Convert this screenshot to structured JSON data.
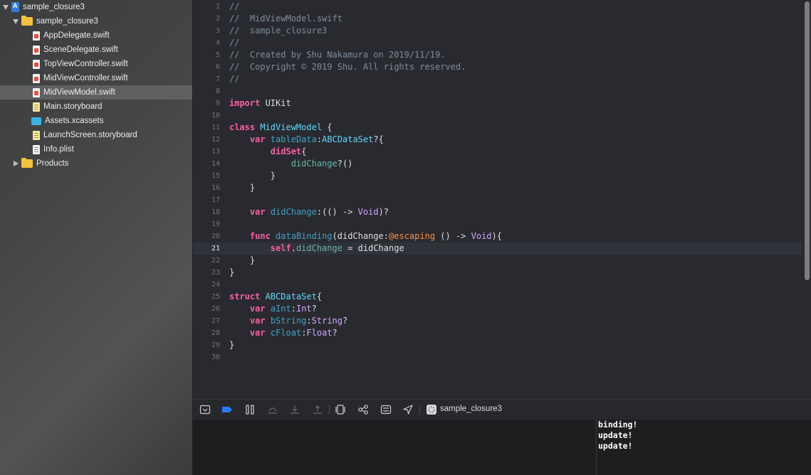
{
  "navigator": {
    "items": [
      {
        "label": "sample_closure3",
        "kind": "project",
        "disclosure": "open"
      },
      {
        "label": "sample_closure3",
        "kind": "folder",
        "disclosure": "open"
      },
      {
        "label": "AppDelegate.swift",
        "kind": "swift"
      },
      {
        "label": "SceneDelegate.swift",
        "kind": "swift"
      },
      {
        "label": "TopViewController.swift",
        "kind": "swift"
      },
      {
        "label": "MidViewController.swift",
        "kind": "swift"
      },
      {
        "label": "MidViewModel.swift",
        "kind": "swift",
        "selected": true
      },
      {
        "label": "Main.storyboard",
        "kind": "storyboard"
      },
      {
        "label": "Assets.xcassets",
        "kind": "assets"
      },
      {
        "label": "LaunchScreen.storyboard",
        "kind": "storyboard"
      },
      {
        "label": "Info.plist",
        "kind": "plist"
      },
      {
        "label": "Products",
        "kind": "folder",
        "disclosure": "closed"
      }
    ]
  },
  "editor": {
    "current_line": 21,
    "lines": [
      {
        "n": "1",
        "tokens": [
          [
            "//",
            "comment"
          ]
        ]
      },
      {
        "n": "2",
        "tokens": [
          [
            "//  MidViewModel.swift",
            "comment"
          ]
        ]
      },
      {
        "n": "3",
        "tokens": [
          [
            "//  sample_closure3",
            "comment"
          ]
        ]
      },
      {
        "n": "4",
        "tokens": [
          [
            "//",
            "comment"
          ]
        ]
      },
      {
        "n": "5",
        "tokens": [
          [
            "//  Created by Shu Nakamura on 2019/11/19.",
            "comment"
          ]
        ]
      },
      {
        "n": "6",
        "tokens": [
          [
            "//  Copyright © 2019 Shu. All rights reserved.",
            "comment"
          ]
        ]
      },
      {
        "n": "7",
        "tokens": [
          [
            "//",
            "comment"
          ]
        ]
      },
      {
        "n": "8",
        "tokens": []
      },
      {
        "n": "9",
        "tokens": [
          [
            "import",
            "keyword"
          ],
          [
            " UIKit",
            "plain"
          ]
        ]
      },
      {
        "n": "10",
        "tokens": []
      },
      {
        "n": "11",
        "tokens": [
          [
            "class",
            "keyword"
          ],
          [
            " ",
            "plain"
          ],
          [
            "MidViewModel",
            "type"
          ],
          [
            " {",
            "plain"
          ]
        ]
      },
      {
        "n": "12",
        "tokens": [
          [
            "    ",
            "plain"
          ],
          [
            "var",
            "keyword"
          ],
          [
            " ",
            "plain"
          ],
          [
            "tableData",
            "prop"
          ],
          [
            ":",
            "plain"
          ],
          [
            "ABCDataSet",
            "type"
          ],
          [
            "?{",
            "plain"
          ]
        ]
      },
      {
        "n": "13",
        "tokens": [
          [
            "        ",
            "plain"
          ],
          [
            "didSet",
            "keyword"
          ],
          [
            "{",
            "plain"
          ]
        ]
      },
      {
        "n": "14",
        "tokens": [
          [
            "            ",
            "plain"
          ],
          [
            "didChange",
            "fn"
          ],
          [
            "?()",
            "plain"
          ]
        ]
      },
      {
        "n": "15",
        "tokens": [
          [
            "        }",
            "plain"
          ]
        ]
      },
      {
        "n": "16",
        "tokens": [
          [
            "    }",
            "plain"
          ]
        ]
      },
      {
        "n": "17",
        "tokens": []
      },
      {
        "n": "18",
        "tokens": [
          [
            "    ",
            "plain"
          ],
          [
            "var",
            "keyword"
          ],
          [
            " ",
            "plain"
          ],
          [
            "didChange",
            "prop"
          ],
          [
            ":(() -> ",
            "plain"
          ],
          [
            "Void",
            "systype"
          ],
          [
            ")?",
            "plain"
          ]
        ]
      },
      {
        "n": "19",
        "tokens": []
      },
      {
        "n": "20",
        "tokens": [
          [
            "    ",
            "plain"
          ],
          [
            "func",
            "keyword"
          ],
          [
            " ",
            "plain"
          ],
          [
            "dataBinding",
            "prop"
          ],
          [
            "(didChange:",
            "plain"
          ],
          [
            "@escaping",
            "attr"
          ],
          [
            " () -> ",
            "plain"
          ],
          [
            "Void",
            "systype"
          ],
          [
            "){",
            "plain"
          ]
        ]
      },
      {
        "n": "21",
        "tokens": [
          [
            "        ",
            "plain"
          ],
          [
            "self",
            "keyword"
          ],
          [
            ".",
            "plain"
          ],
          [
            "didChange",
            "fn"
          ],
          [
            " = didChange",
            "plain"
          ]
        ]
      },
      {
        "n": "22",
        "tokens": [
          [
            "    }",
            "plain"
          ]
        ]
      },
      {
        "n": "23",
        "tokens": [
          [
            "}",
            "plain"
          ]
        ]
      },
      {
        "n": "24",
        "tokens": []
      },
      {
        "n": "25",
        "tokens": [
          [
            "struct",
            "keyword"
          ],
          [
            " ",
            "plain"
          ],
          [
            "ABCDataSet",
            "type"
          ],
          [
            "{",
            "plain"
          ]
        ]
      },
      {
        "n": "26",
        "tokens": [
          [
            "    ",
            "plain"
          ],
          [
            "var",
            "keyword"
          ],
          [
            " ",
            "plain"
          ],
          [
            "aInt",
            "prop"
          ],
          [
            ":",
            "plain"
          ],
          [
            "Int",
            "systype"
          ],
          [
            "?",
            "plain"
          ]
        ]
      },
      {
        "n": "27",
        "tokens": [
          [
            "    ",
            "plain"
          ],
          [
            "var",
            "keyword"
          ],
          [
            " ",
            "plain"
          ],
          [
            "bString",
            "prop"
          ],
          [
            ":",
            "plain"
          ],
          [
            "String",
            "systype"
          ],
          [
            "?",
            "plain"
          ]
        ]
      },
      {
        "n": "28",
        "tokens": [
          [
            "    ",
            "plain"
          ],
          [
            "var",
            "keyword"
          ],
          [
            " ",
            "plain"
          ],
          [
            "cFloat",
            "prop"
          ],
          [
            ":",
            "plain"
          ],
          [
            "Float",
            "systype"
          ],
          [
            "?",
            "plain"
          ]
        ]
      },
      {
        "n": "29",
        "tokens": [
          [
            "}",
            "plain"
          ]
        ]
      },
      {
        "n": "30",
        "tokens": []
      }
    ]
  },
  "debug_bar": {
    "buttons": [
      {
        "name": "hide-debug-area-icon",
        "enabled": true
      },
      {
        "name": "breakpoints-toggle-icon",
        "enabled": true,
        "accent": "#2a7aff"
      },
      {
        "name": "pause-continue-icon",
        "enabled": true
      },
      {
        "name": "step-over-icon",
        "enabled": false
      },
      {
        "name": "step-into-icon",
        "enabled": false
      },
      {
        "name": "step-out-icon",
        "enabled": false
      },
      {
        "name": "debug-view-hierarchy-icon",
        "enabled": true
      },
      {
        "name": "debug-memory-graph-icon",
        "enabled": true
      },
      {
        "name": "environment-overrides-icon",
        "enabled": true
      },
      {
        "name": "simulate-location-icon",
        "enabled": true
      }
    ],
    "process_label": "sample_closure3"
  },
  "console": {
    "lines": [
      "binding!",
      "update!",
      "update!"
    ]
  }
}
